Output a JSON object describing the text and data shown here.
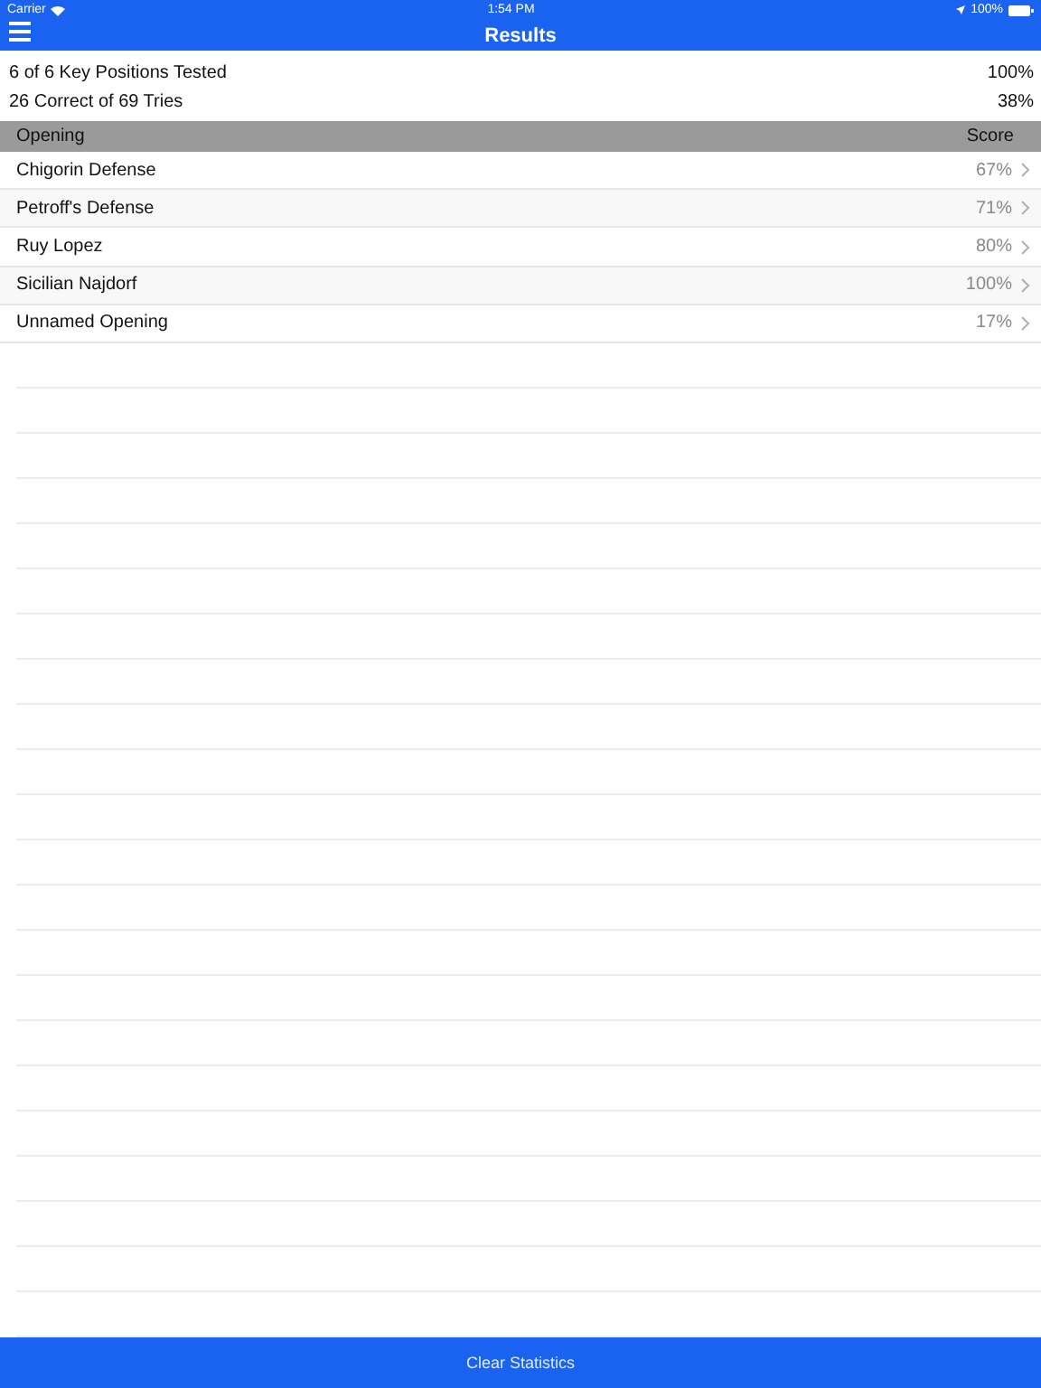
{
  "status_bar": {
    "carrier": "Carrier",
    "time": "1:54 PM",
    "battery": "100%"
  },
  "nav": {
    "title": "Results"
  },
  "summary": [
    {
      "label": "6 of 6 Key Positions Tested",
      "value": "100%"
    },
    {
      "label": "26 Correct of 69 Tries",
      "value": "38%"
    }
  ],
  "table": {
    "columns": [
      "Opening",
      "Score"
    ],
    "rows": [
      {
        "opening": "Chigorin Defense",
        "score": "67%"
      },
      {
        "opening": "Petroff's Defense",
        "score": "71%"
      },
      {
        "opening": "Ruy Lopez",
        "score": "80%"
      },
      {
        "opening": "Sicilian Najdorf",
        "score": "100%"
      },
      {
        "opening": "Unnamed Opening",
        "score": "17%"
      }
    ]
  },
  "bottom_button": "Clear Statistics"
}
